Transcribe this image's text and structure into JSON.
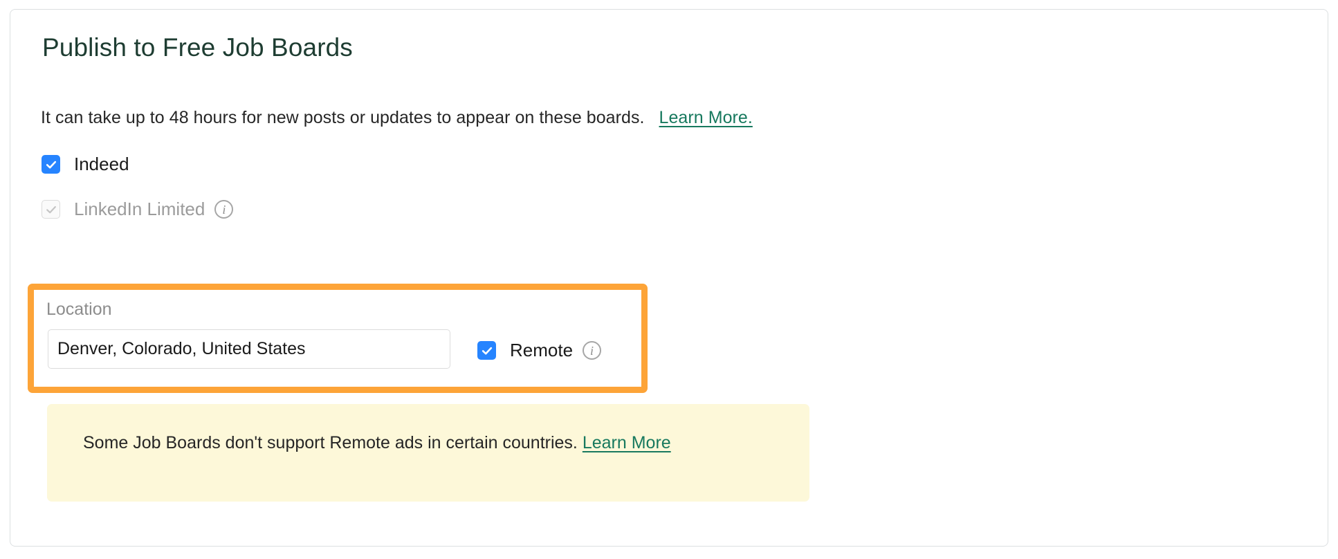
{
  "card": {
    "title": "Publish to Free Job Boards",
    "intro": {
      "text": "It can take up to 48 hours for new posts or updates to appear on these boards.",
      "link_label": "Learn More."
    },
    "boards": [
      {
        "id": "indeed",
        "label": "Indeed",
        "checked": true,
        "disabled": false,
        "has_info": false
      },
      {
        "id": "linkedin-limited",
        "label": "LinkedIn Limited",
        "checked": true,
        "disabled": true,
        "has_info": true,
        "info_glyph": "i"
      }
    ],
    "location": {
      "label": "Location",
      "value": "Denver, Colorado, United States",
      "placeholder": "Location",
      "remote": {
        "label": "Remote",
        "checked": true,
        "info_glyph": "i"
      }
    },
    "notice": {
      "text": "Some Job Boards don't support Remote ads in certain countries. ",
      "link_label": "Learn More"
    }
  },
  "colors": {
    "title": "#1e3d32",
    "link": "#17795e",
    "checkbox_checked": "#2684ff",
    "highlight_border": "#fda438",
    "notice_background": "#fdf8d9",
    "card_border": "#dcdfe1",
    "muted_text": "#9b9b9b"
  }
}
